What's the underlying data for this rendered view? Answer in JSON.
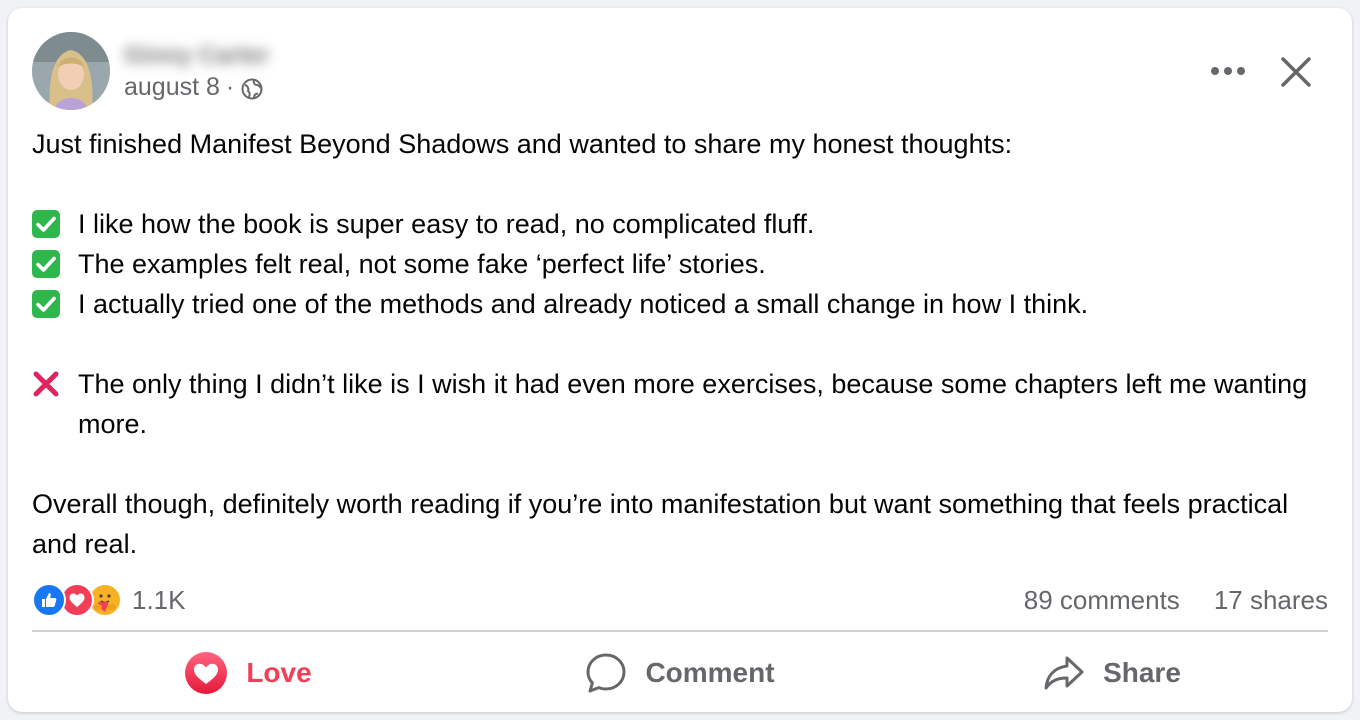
{
  "post": {
    "author_name": "Ginny Carter",
    "date": "august 8",
    "separator": "·",
    "privacy_icon": "globe-icon",
    "intro": "Just finished Manifest Beyond Shadows and wanted to share my honest thoughts:",
    "pros": [
      "I like how the book is super easy to read, no complicated fluff.",
      "The examples felt real, not some fake ‘perfect life’ stories.",
      "I actually tried one of the methods and already noticed a small change in how I think."
    ],
    "con": "The only thing I didn’t like is I wish it had even more exercises, because some chapters left me wanting more.",
    "conclusion": "Overall though, definitely worth reading if you’re into manifestation but want something that feels practical and real."
  },
  "stats": {
    "reactions": [
      "like-icon",
      "heart-icon",
      "care-icon"
    ],
    "reaction_count": "1.1K",
    "comments": "89 comments",
    "shares": "17 shares"
  },
  "actions": {
    "love_label": "Love",
    "comment_label": "Comment",
    "share_label": "Share"
  },
  "colors": {
    "love": "#f33e58",
    "like_blue": "#1877f2",
    "check_green": "#2eb84b",
    "cross_red": "#e0245e",
    "muted_text": "#65676b"
  }
}
